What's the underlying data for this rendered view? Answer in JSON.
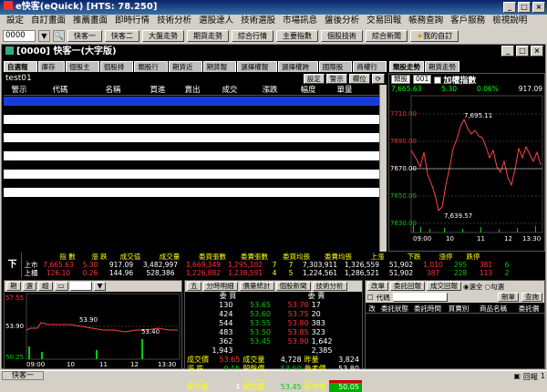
{
  "app": {
    "title": "e快客(eQuick) [HTS: 78.250]"
  },
  "menu": [
    "設定",
    "自訂畫面",
    "推薦畫面",
    "即時行情",
    "技術分析",
    "選股達人",
    "技術選股",
    "市場訊息",
    "盤後分析",
    "交易回報",
    "帳務查詢",
    "客戶服務",
    "檢視說明"
  ],
  "toolbar": {
    "stock_code": "0000",
    "buttons": [
      "快客一",
      "快客二",
      "大盤走勢",
      "期貨走勢",
      "綜合行情",
      "主要指數",
      "個股技術",
      "綜合新聞"
    ],
    "favorite": "我的自訂"
  },
  "window": {
    "title": "[0000] 快客一(大字版)"
  },
  "tabs_left": [
    "自選報價",
    "庫存股",
    "個股主題",
    "個股排行",
    "類股行情",
    "期貨近月",
    "期貨報價",
    "選擇權報價",
    "選擇權跨月",
    "國際股指",
    "商權行情"
  ],
  "tabs_right": [
    "類股走勢",
    "期貨走勢"
  ],
  "list": {
    "name": "test01",
    "buttons": [
      "設定",
      "警示",
      "欄位"
    ],
    "columns": [
      "警示",
      "代碼",
      "名稱",
      "買進",
      "賣出",
      "成交",
      "漲跌",
      "幅度",
      "單量"
    ]
  },
  "right_chart": {
    "select": "類股",
    "code_select": "001",
    "checkbox_label": "加權指數",
    "price_now": "7,665.63",
    "change": "5.30",
    "pct": "0.06%",
    "volume": "917.09",
    "y_ticks": [
      "7710.00",
      "7690.00",
      "7670.00",
      "7650.00",
      "7630.00"
    ],
    "x_ticks": [
      "09:00",
      "10",
      "11",
      "12",
      "13:30"
    ],
    "high_label": "7,695.11",
    "low_label": "7,639.57"
  },
  "quote": {
    "label": "下單",
    "headers": [
      "指 數",
      "漲 跌",
      "成交值",
      "成交量",
      "委買張數",
      "委賣張數",
      "委買均張",
      "委賣均張",
      "上漲",
      "下跌",
      "漲停",
      "跌停"
    ],
    "rows": [
      [
        "上市",
        "7,665.63",
        "5.30",
        "917.09",
        "3,482,997",
        "1,669,349",
        "1,295,102",
        "7",
        "7",
        "7,303,911",
        "1,326,559",
        "51,902",
        "1,010",
        "295",
        "381",
        "6"
      ],
      [
        "上櫃",
        "126.10",
        "0.26",
        "144.96",
        "528,386",
        "1,226,882",
        "1,238,591",
        "4",
        "5",
        "1,224,561",
        "1,286,521",
        "51,902",
        "387",
        "228",
        "113",
        "2"
      ]
    ]
  },
  "minichart": {
    "buttons": [
      "期",
      "選",
      "超"
    ],
    "y_ticks": [
      "57.55",
      "53.90",
      "50.25"
    ],
    "x_ticks": [
      "09:00",
      "10",
      "11",
      "12",
      "13:30"
    ],
    "marks": [
      "53.90",
      "53.40"
    ]
  },
  "orderbook": {
    "buttons": [
      "五",
      "分時明細",
      "價量統計",
      "個股新聞",
      "技術分析"
    ],
    "headers": [
      "委 買",
      "委 賣"
    ],
    "rows": [
      [
        "130",
        "53.65",
        "53.70",
        "17"
      ],
      [
        "424",
        "53.60",
        "53.75",
        "20"
      ],
      [
        "544",
        "53.55",
        "53.80",
        "383"
      ],
      [
        "483",
        "53.50",
        "53.85",
        "323"
      ],
      [
        "362",
        "53.45",
        "53.90",
        "1,642"
      ]
    ],
    "totals": [
      "1,943",
      "2,385"
    ],
    "summary": [
      [
        "成交價",
        "53.65",
        "成交量",
        "4,728",
        "昨量",
        "3,824"
      ],
      [
        "漲 跌",
        "0.15",
        "開盤價",
        "53.50",
        "參考價",
        "53.80"
      ],
      [
        "幅 度",
        "0.28%",
        "最高價",
        "53.90",
        "漲停價",
        "57.55"
      ],
      [
        "開合量",
        "4",
        "最低價",
        "53.45",
        "跌停價",
        "50.05"
      ]
    ]
  },
  "orders": {
    "buttons": [
      "改單",
      "委託回報",
      "成交回報"
    ],
    "radio_all": "選全",
    "radio_sel": "勾選",
    "code_label": "代碼",
    "buttons2": [
      "刪單",
      "查詢"
    ],
    "columns": [
      "改",
      "委託狀態",
      "委託時間",
      "買賣別",
      "商品名稱",
      "委託價"
    ]
  },
  "status": {
    "left": "快客一",
    "right": [
      "回報",
      "1"
    ]
  }
}
